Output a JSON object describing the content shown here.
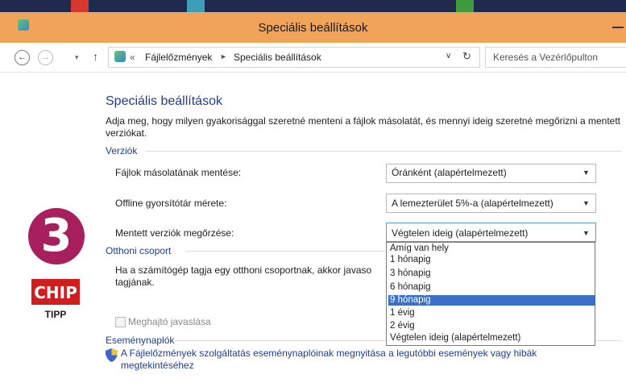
{
  "window": {
    "title": "Speciális beállítások"
  },
  "address": {
    "separator": "«",
    "crumbs": [
      "Fájlelőzmények",
      "Speciális beállítások"
    ],
    "search_placeholder": "Keresés a Vezérlőpulton"
  },
  "nav": {
    "back": "←",
    "forward": "→",
    "recent": "▾",
    "up": "↑",
    "dropdown": "∨",
    "refresh": "↻",
    "crumb_arrow": "►"
  },
  "content": {
    "title": "Speciális beállítások",
    "intro": "Adja meg, hogy milyen gyakorisággal szeretné menteni a fájlok másolatát, és mennyi ideig szeretné megőrizni a mentett verziókat.",
    "versions": {
      "heading": "Verziók",
      "rows": [
        {
          "label": "Fájlok másolatának mentése:",
          "value": "Óránként (alapértelmezett)"
        },
        {
          "label": "Offline gyorsítótár mérete:",
          "value": "A lemezterület 5%-a (alapértelmezett)"
        },
        {
          "label": "Mentett verziók megőrzése:",
          "value": "Végtelen ideig (alapértelmezett)"
        }
      ],
      "dropdown_options": [
        "Amíg van hely",
        "1 hónapig",
        "3 hónapig",
        "6 hónapig",
        "9 hónapig",
        "1 évig",
        "2 évig",
        "Végtelen ideig (alapértelmezett)"
      ],
      "highlighted_option": "9 hónapig"
    },
    "homegroup": {
      "heading": "Otthoni csoport",
      "text": "Ha a számítógép tagja egy otthoni csoportnak, akkor javaso tagjának.",
      "checkbox_label": "Meghajtó javaslása"
    },
    "events": {
      "heading": "Eseménynaplók",
      "link": "A Fájlelőzmények szolgáltatás eseménynaplóinak megnyitása a legutóbbi események vagy hibák megtekintéséhez"
    }
  },
  "badge": {
    "number": "3",
    "logo": "CHIP",
    "tipp": "TIPP"
  },
  "colors": {
    "titlebar": "#f2a35a",
    "heading": "#1f3d8f",
    "badge": "#a71f5c",
    "logo_red": "#d01e1e",
    "selection": "#3c70c7"
  },
  "icons": [
    "app-icon",
    "back-icon",
    "forward-icon",
    "up-icon",
    "refresh-icon",
    "shield-icon",
    "chevron-down-icon"
  ]
}
